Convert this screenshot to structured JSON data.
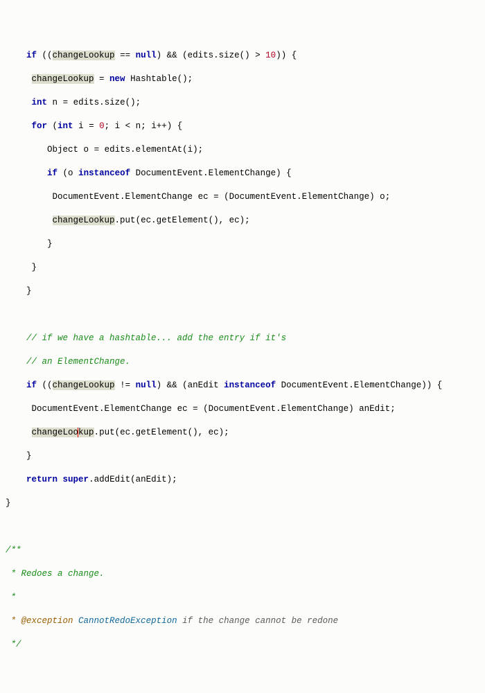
{
  "code": {
    "t_if": "if",
    "t_null": "null",
    "t_new": "new",
    "t_int": "int",
    "t_for": "for",
    "t_return": "return",
    "t_instanceof": "instanceof",
    "v_changeLookup": "changeLookup",
    "v_edits": "edits",
    "m_size": "size",
    "m_elementAt": "elementAt",
    "m_put": "put",
    "m_getElement": "getElement",
    "m_addEdit": "addEdit",
    "t_Hashtable": "Hashtable",
    "t_Object": "Object",
    "t_DocumentEventElementChange": "DocumentEvent.ElementChange",
    "v_ec": "ec",
    "v_o": "o",
    "v_n": "n",
    "v_i": "i",
    "v_anEdit": "anEdit",
    "t_super": "super",
    "num_0": "0",
    "num_10": "10",
    "comment_hash1": "// if we have a hashtable... add the entry if it's",
    "comment_hash2": "// an ElementChange.",
    "jdoc_open": "/**",
    "jdoc_l1": " * Redoes a change.",
    "jdoc_l2": " *",
    "jdoc_tag": " * @exception",
    "jdoc_exc": "CannotRedoException",
    "jdoc_desc": "if the change cannot be redone",
    "jdoc_close": " */"
  }
}
